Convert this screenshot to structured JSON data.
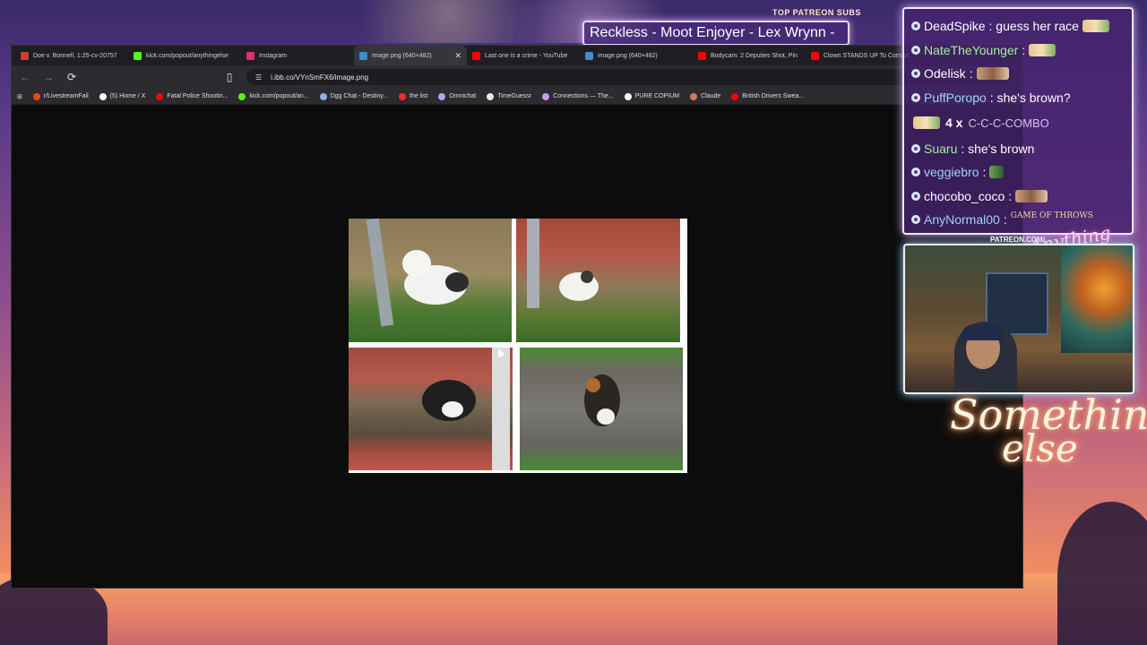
{
  "overlay": {
    "patreon_header": "TOP PATREON SUBS",
    "subs_banner": "Reckless - Moot Enjoyer - Lex Wrynn -",
    "patreon_link": "PATREON.COM/",
    "brand_script": "Anything Else?",
    "neon_line1": "Something",
    "neon_line2": "else"
  },
  "browser": {
    "tabs": [
      {
        "label": "Doe v. Bonnell, 1:25-cv-20757",
        "color": "#d23b3b",
        "active": false
      },
      {
        "label": "kick.com/popout/anythingelse",
        "color": "#53fc18",
        "active": false
      },
      {
        "label": "Instagram",
        "color": "#e1306c",
        "active": false
      },
      {
        "label": "image.png (640×482)",
        "color": "#3b8fd6",
        "active": true,
        "close": "✕"
      },
      {
        "label": "Last one is a crime - YouTube",
        "color": "#ff0000",
        "active": false
      },
      {
        "label": "image.png (640×482)",
        "color": "#3b8fd6",
        "active": false
      },
      {
        "label": "Bodycam: 2 Deputies Shot, Pin",
        "color": "#ff0000",
        "active": false
      },
      {
        "label": "Clown STANDS UP To Corrupt",
        "color": "#ff0000",
        "active": false
      }
    ],
    "url": "i.ibb.co/VYnSmFX6/image.png",
    "bookmarks": [
      {
        "label": "r/LivestreamFail",
        "color": "#ff4500"
      },
      {
        "label": "(5) Home / X",
        "color": "#ffffff"
      },
      {
        "label": "Fatal Police Shootin...",
        "color": "#ff0000"
      },
      {
        "label": "kick.com/popout/an...",
        "color": "#53fc18"
      },
      {
        "label": "Dgg Chat - Destiny...",
        "color": "#8fb0e0"
      },
      {
        "label": "the list",
        "color": "#ff2a2a"
      },
      {
        "label": "Omnichat",
        "color": "#b9a3f0"
      },
      {
        "label": "TimeGuessr",
        "color": "#e9e9e9"
      },
      {
        "label": "Connections — The...",
        "color": "#c79af0"
      },
      {
        "label": "PURE COPIUM",
        "color": "#ffffff"
      },
      {
        "label": "Claude",
        "color": "#d97757"
      },
      {
        "label": "British Drivers Swea...",
        "color": "#ff0000"
      }
    ]
  },
  "chat": {
    "messages": [
      {
        "user": "DeadSpike",
        "user_color": "#ffffff",
        "text": ": guess her race",
        "emote": "wide"
      },
      {
        "user": "NateTheYounger",
        "user_color": "#9ef0a0",
        "text": ":",
        "emote": "wide"
      },
      {
        "user": "Odelisk",
        "user_color": "#ffffff",
        "text": ":",
        "emote": "face"
      },
      {
        "user": "PuffPoropo",
        "user_color": "#9fd2ff",
        "text": ": she's brown?",
        "emote": ""
      },
      {
        "combo_count": "4 x",
        "combo_text": "C-C-C-COMBO"
      },
      {
        "user": "Suaru",
        "user_color": "#9ef0a0",
        "text": ": she's brown",
        "emote": ""
      },
      {
        "user": "veggiebro",
        "user_color": "#9fd2ff",
        "text": ":",
        "emote": "small"
      },
      {
        "user": "chocobo_coco",
        "user_color": "#ffffff",
        "text": ":",
        "emote": "face"
      },
      {
        "user": "AnyNormal00",
        "user_color": "#9fd2ff",
        "text": ":",
        "emote": "got",
        "emote_text": "GAME OF THROWS"
      }
    ]
  }
}
